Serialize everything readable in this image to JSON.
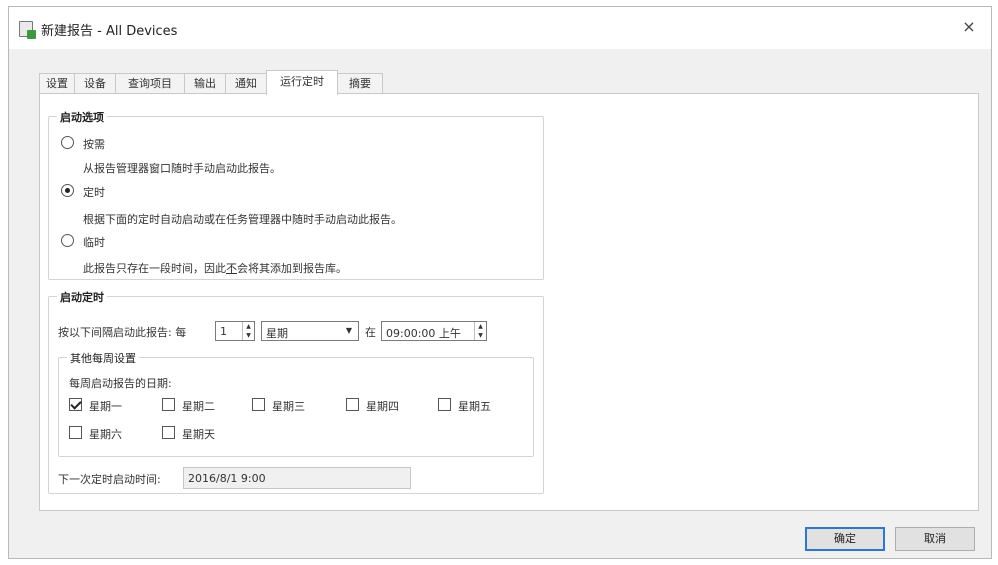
{
  "window": {
    "title": "新建报告 - All Devices",
    "close_symbol": "×"
  },
  "tabs": [
    {
      "label": "设置",
      "active": false
    },
    {
      "label": "设备",
      "active": false
    },
    {
      "label": "查询项目",
      "active": false
    },
    {
      "label": "输出",
      "active": false
    },
    {
      "label": "通知",
      "active": false
    },
    {
      "label": "运行定时",
      "active": true
    },
    {
      "label": "摘要",
      "active": false
    }
  ],
  "startup_options": {
    "group_label": "启动选项",
    "options": [
      {
        "label": "按需",
        "description": "从报告管理器窗口随时手动启动此报告。",
        "checked": false
      },
      {
        "label": "定时",
        "description": "根据下面的定时自动启动或在任务管理器中随时手动启动此报告。",
        "checked": true
      },
      {
        "label": "临时",
        "description_before": "此报告只存在一段时间，因此",
        "description_emph": "不",
        "description_after": "会将其添加到报告库。",
        "checked": false
      }
    ]
  },
  "schedule": {
    "group_label": "启动定时",
    "interval_label": "按以下间隔启动此报告: 每",
    "interval_value": "1",
    "unit_value": "星期",
    "at_label": "在",
    "time_value": "09:00:00 上午",
    "weekly": {
      "group_label": "其他每周设置",
      "days_label": "每周启动报告的日期:",
      "days": [
        {
          "label": "星期一",
          "checked": true
        },
        {
          "label": "星期二",
          "checked": false
        },
        {
          "label": "星期三",
          "checked": false
        },
        {
          "label": "星期四",
          "checked": false
        },
        {
          "label": "星期五",
          "checked": false
        },
        {
          "label": "星期六",
          "checked": false
        },
        {
          "label": "星期天",
          "checked": false
        }
      ]
    },
    "next_run_label": "下一次定时启动时间:",
    "next_run_value": "2016/8/1 9:00"
  },
  "buttons": {
    "ok": "确定",
    "cancel": "取消"
  },
  "icons": {
    "app": "report-app-icon",
    "close": "close-icon",
    "spin": "spin-arrows-icon",
    "dropdown": "chevron-down-icon"
  }
}
